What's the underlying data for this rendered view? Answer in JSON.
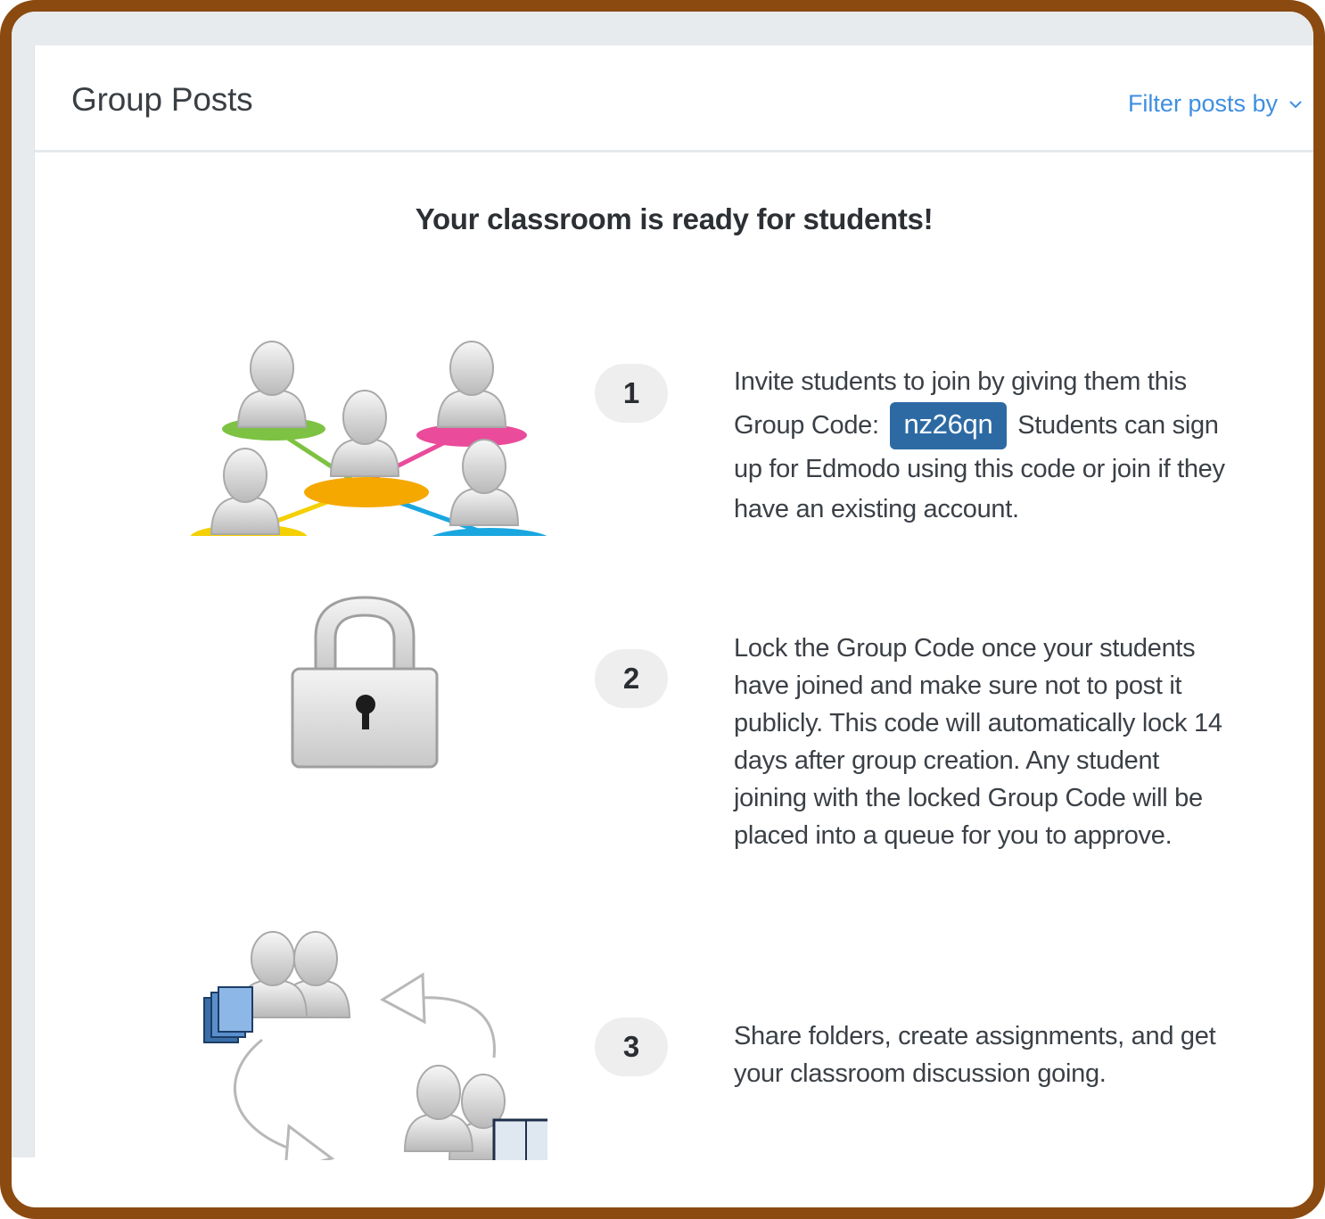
{
  "header": {
    "title": "Group Posts",
    "filter_label": "Filter posts by",
    "filter_icon": "chevron-down-icon"
  },
  "headline": "Your classroom is ready for students!",
  "steps": [
    {
      "number": "1",
      "text_before": "Invite students to join by giving them this Group Code:",
      "group_code": "nz26qn",
      "text_after": "Students can sign up for Edmodo using this code or join if they have an existing account.",
      "icon": "student-network-icon"
    },
    {
      "number": "2",
      "text": "Lock the Group Code once your students have joined and make sure not to post it publicly. This code will automatically lock 14 days after group creation. Any student joining with the locked Group Code will be placed into a queue for you to approve.",
      "icon": "padlock-icon"
    },
    {
      "number": "3",
      "text": "Share folders, create assignments, and get your classroom discussion going.",
      "icon": "share-folders-icon"
    }
  ],
  "colors": {
    "frame": "#8b4a10",
    "code_badge": "#2d6aa4",
    "link": "#3f8fe0"
  }
}
